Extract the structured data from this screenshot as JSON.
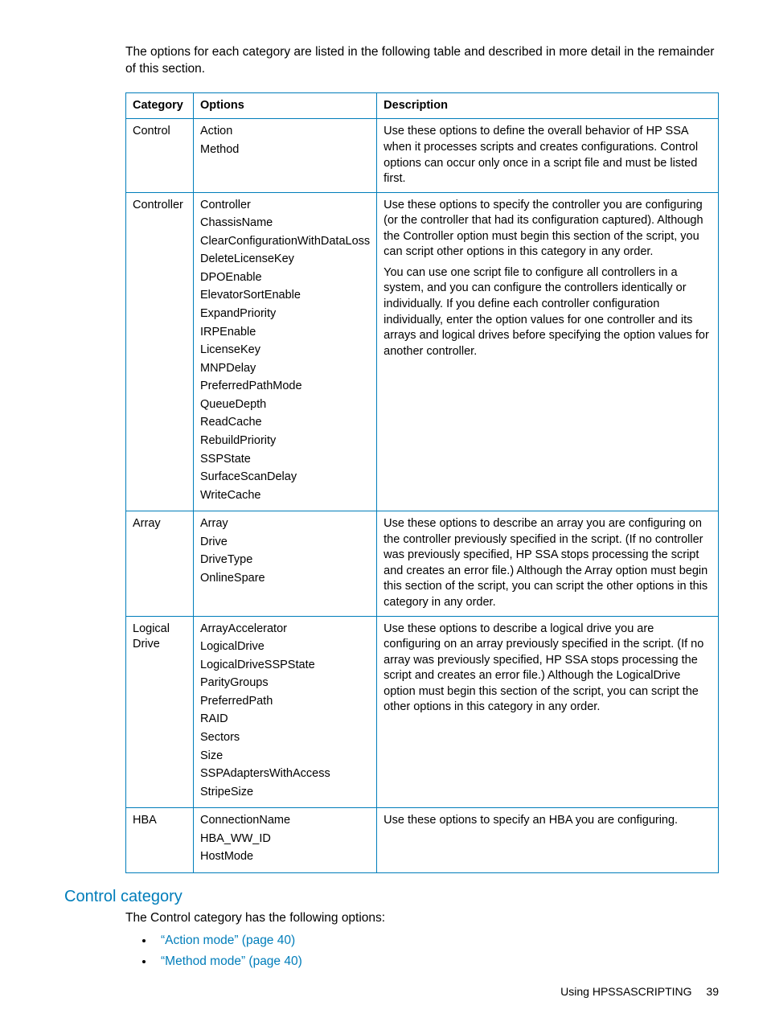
{
  "intro": "The options for each category are listed in the following table and described in more detail in the remainder of this section.",
  "table": {
    "headers": {
      "category": "Category",
      "options": "Options",
      "description": "Description"
    },
    "rows": [
      {
        "category": "Control",
        "options": [
          "Action",
          "Method"
        ],
        "description": [
          "Use these options to define the overall behavior of HP SSA when it processes scripts and creates configurations. Control options can occur only once in a script file and must be listed first."
        ]
      },
      {
        "category": "Controller",
        "options": [
          "Controller",
          "ChassisName",
          "ClearConfigurationWithDataLoss",
          "DeleteLicenseKey",
          "DPOEnable",
          "ElevatorSortEnable",
          "ExpandPriority",
          "IRPEnable",
          "LicenseKey",
          "MNPDelay",
          "PreferredPathMode",
          "QueueDepth",
          "ReadCache",
          "RebuildPriority",
          "SSPState",
          "SurfaceScanDelay",
          "WriteCache"
        ],
        "description": [
          "Use these options to specify the controller you are configuring (or the controller that had its configuration captured). Although the Controller option must begin this section of the script, you can script other options in this category in any order.",
          "You can use one script file to configure all controllers in a system, and you can configure the controllers identically or individually. If you define each controller configuration individually, enter the option values for one controller and its arrays and logical drives before specifying the option values for another controller."
        ]
      },
      {
        "category": "Array",
        "options": [
          "Array",
          "Drive",
          "DriveType",
          "OnlineSpare"
        ],
        "description": [
          "Use these options to describe an array you are configuring on the controller previously specified in the script. (If no controller was previously specified, HP SSA stops processing the script and creates an error file.) Although the Array option must begin this section of the script, you can script the other options in this category in any order."
        ]
      },
      {
        "category": "Logical Drive",
        "options": [
          "ArrayAccelerator",
          "LogicalDrive",
          "LogicalDriveSSPState",
          "ParityGroups",
          "PreferredPath",
          "RAID",
          "Sectors",
          "Size",
          "SSPAdaptersWithAccess",
          "StripeSize"
        ],
        "description": [
          "Use these options to describe a logical drive you are configuring on an array previously specified in the script. (If no array was previously specified, HP SSA stops processing the script and creates an error file.) Although the LogicalDrive option must begin this section of the script, you can script the other options in this category in any order."
        ]
      },
      {
        "category": "HBA",
        "options": [
          "ConnectionName",
          "HBA_WW_ID",
          "HostMode"
        ],
        "description": [
          "Use these options to specify an HBA you are configuring."
        ]
      }
    ]
  },
  "section_title": "Control category",
  "sub_intro": "The Control category has the following options:",
  "links": [
    "“Action mode” (page 40)",
    "“Method mode” (page 40)"
  ],
  "footer": {
    "text": "Using HPSSASCRIPTING",
    "page": "39"
  }
}
